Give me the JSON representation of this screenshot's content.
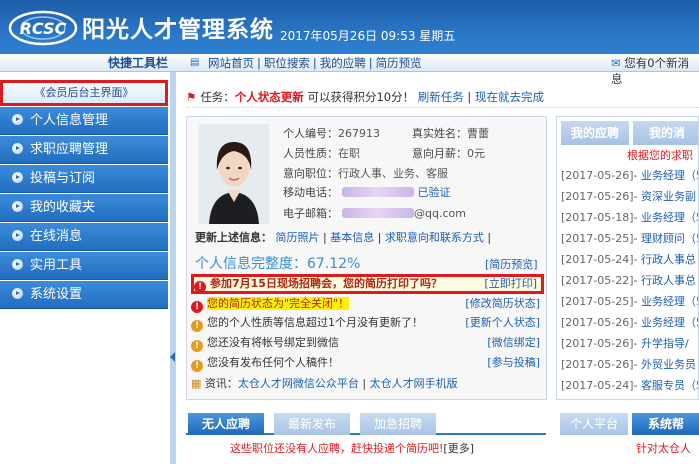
{
  "header": {
    "logo_text": "RCSC",
    "title": "阳光人才管理系统",
    "datetime": "2017年05月26日 09:53 星期五"
  },
  "nav": {
    "quick_toolbar": "快捷工具栏",
    "links": [
      "网站首页",
      "职位搜索",
      "我的应聘",
      "简历预览"
    ],
    "message": "您有0个新消息"
  },
  "sidebar": {
    "home": "《会员后台主界面》",
    "items": [
      "个人信息管理",
      "求职应聘管理",
      "投稿与订阅",
      "我的收藏夹",
      "在线消息",
      "实用工具",
      "系统设置"
    ]
  },
  "task": {
    "label": "任务：",
    "name": "个人状态更新",
    "desc": "可以获得积分10分！",
    "refresh": "刷新任务",
    "complete": "现在就去完成"
  },
  "profile": {
    "id_label": "个人编号：",
    "id": "267913",
    "name_label": "真实姓名：",
    "name": "曹蕾",
    "nature_label": "人员性质：",
    "nature": "在职",
    "salary_label": "意向月薪：",
    "salary": "0元",
    "position_label": "意向职位：",
    "position": "行政人事、业务、客服",
    "mobile_label": "移动电话：",
    "verified": "已验证",
    "email_label": "电子邮箱：",
    "email_suffix": "@qq.com"
  },
  "update": {
    "label": "更新上述信息：",
    "links": [
      "简历照片",
      "基本信息",
      "求职意向和联系方式"
    ]
  },
  "completeness": {
    "label": "个人信息完整度：",
    "value": "67.12%",
    "preview": "[简历预览]"
  },
  "alerts": [
    {
      "text": "参加7月15日现场招聘会，您的简历打印了吗？",
      "action": "[立即打印]"
    },
    {
      "text_pre": "您的简历状态为",
      "text_hl": "\"完全关闭\"！",
      "action": "[修改简历状态]"
    },
    {
      "text": "您的个人性质等信息超过1个月没有更新了！",
      "action": "[更新个人状态]"
    },
    {
      "text": "您还没有将帐号绑定到微信",
      "action": "[微信绑定]"
    },
    {
      "text": "您没有发布任何个人稿件！",
      "action": "[参与投稿]"
    }
  ],
  "info": {
    "label": "资讯：",
    "links": [
      "太仓人才网微信公众平台",
      "太仓人才网手机版"
    ]
  },
  "bottom_tabs": [
    "无人应聘",
    "最新发布",
    "加急招聘"
  ],
  "bottom_msg": {
    "text": "这些职位还没有人应聘，赶快投递个简历吧!",
    "more": "[更多]"
  },
  "right": {
    "tabs": [
      "我的应聘",
      "我的消"
    ],
    "head": "根据您的求职",
    "items": [
      {
        "date": "[2017-05-26]",
        "job": "- 业务经理（5"
      },
      {
        "date": "[2017-05-26]",
        "job": "- 资深业务副"
      },
      {
        "date": "[2017-05-18]",
        "job": "- 业务经理（5"
      },
      {
        "date": "[2017-05-25]",
        "job": "- 理财顾问（5"
      },
      {
        "date": "[2017-05-24]",
        "job": "- 行政人事总"
      },
      {
        "date": "[2017-05-22]",
        "job": "- 行政人事总"
      },
      {
        "date": "[2017-05-25]",
        "job": "- 业务经理（5"
      },
      {
        "date": "[2017-05-26]",
        "job": "- 业务经理（5"
      },
      {
        "date": "[2017-05-26]",
        "job": "- 升学指导/"
      },
      {
        "date": "[2017-05-26]",
        "job": "- 外贸业务员"
      },
      {
        "date": "[2017-05-24]",
        "job": "- 客服专员（5"
      }
    ],
    "tabs2": [
      "个人平台",
      "系统帮"
    ],
    "msg2": "针对太仓人"
  }
}
